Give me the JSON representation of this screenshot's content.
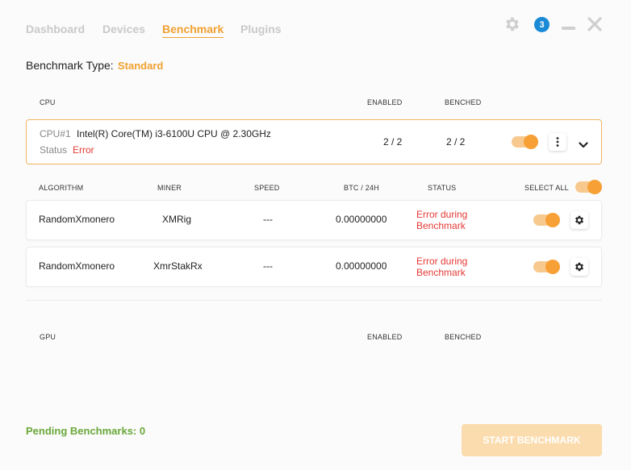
{
  "nav": {
    "tabs": [
      "Dashboard",
      "Devices",
      "Benchmark",
      "Plugins"
    ],
    "active": "Benchmark"
  },
  "window": {
    "notification_count": "3"
  },
  "benchmark_type": {
    "label": "Benchmark Type:",
    "value": "Standard"
  },
  "cpu_section": {
    "headers": {
      "device": "CPU",
      "enabled": "ENABLED",
      "benched": "BENCHED"
    },
    "device": {
      "id": "CPU#1",
      "name": "Intel(R) Core(TM) i3-6100U CPU @ 2.30GHz",
      "status_label": "Status",
      "status_value": "Error",
      "enabled": "2 / 2",
      "benched": "2 / 2"
    }
  },
  "algo_table": {
    "headers": {
      "algorithm": "ALGORITHM",
      "miner": "MINER",
      "speed": "SPEED",
      "btc": "BTC / 24H",
      "status": "STATUS",
      "select_all": "SELECT ALL"
    },
    "rows": [
      {
        "algorithm": "RandomXmonero",
        "miner": "XMRig",
        "speed": "---",
        "btc": "0.00000000",
        "status_line1": "Error during",
        "status_line2": "Benchmark"
      },
      {
        "algorithm": "RandomXmonero",
        "miner": "XmrStakRx",
        "speed": "---",
        "btc": "0.00000000",
        "status_line1": "Error during",
        "status_line2": "Benchmark"
      }
    ]
  },
  "gpu_section": {
    "headers": {
      "device": "GPU",
      "enabled": "ENABLED",
      "benched": "BENCHED"
    }
  },
  "footer": {
    "pending": "Pending Benchmarks: 0",
    "start_button": "START BENCHMARK"
  },
  "colors": {
    "accent": "#f0a030",
    "error": "#e53935",
    "success": "#6aa83a",
    "badge": "#1a8ad6"
  },
  "icons": [
    "gear-icon",
    "notification-badge",
    "minimize-icon",
    "close-icon",
    "more-vertical-icon",
    "chevron-down-icon",
    "row-settings-icon"
  ]
}
